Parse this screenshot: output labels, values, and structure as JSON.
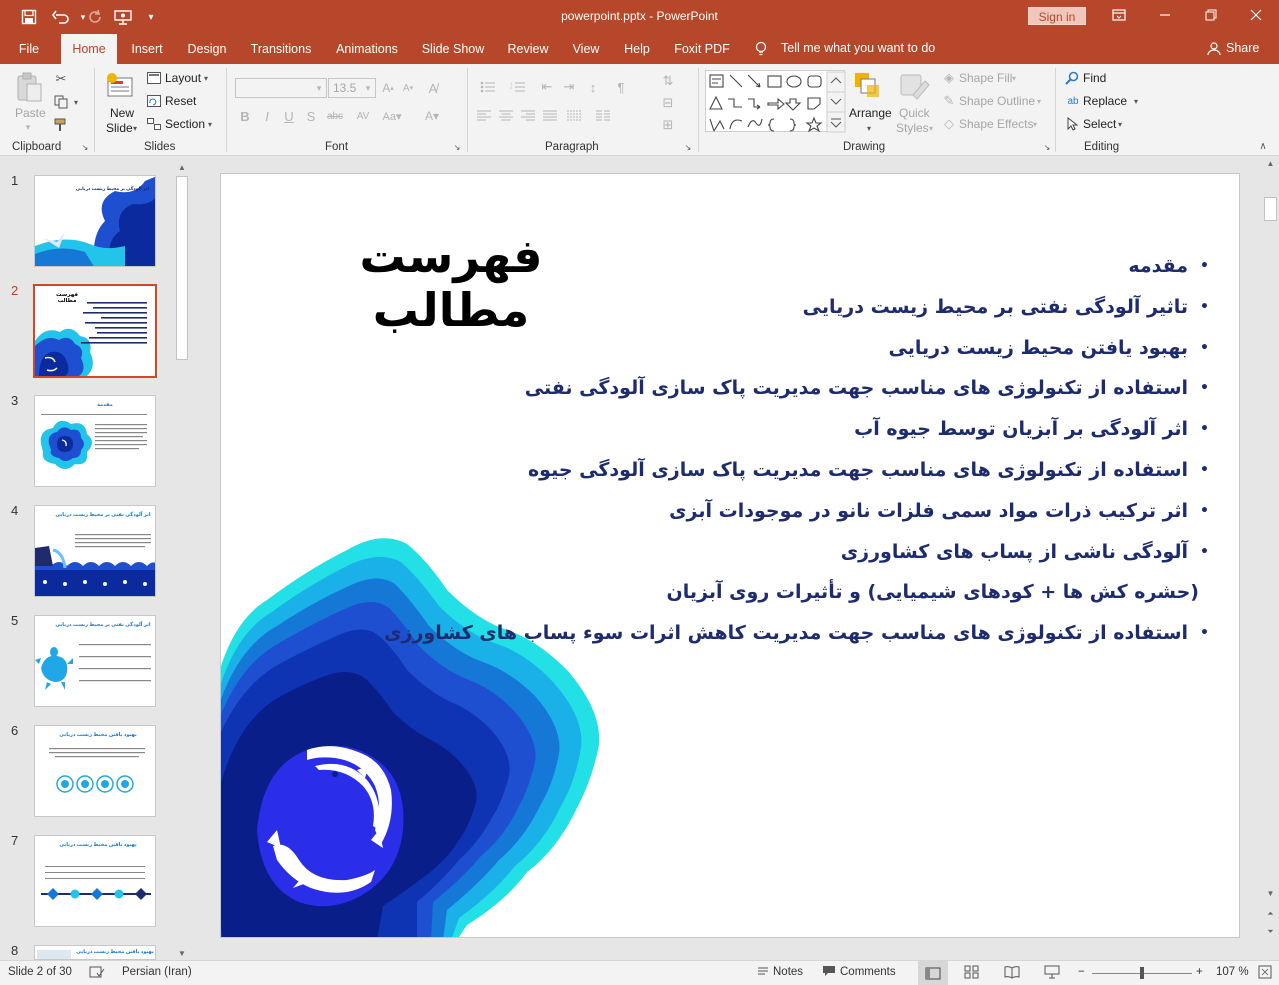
{
  "window": {
    "doc_title": "powerpoint.pptx  -  PowerPoint",
    "sign_in": "Sign in",
    "share": "Share"
  },
  "tabs": [
    {
      "label": "File"
    },
    {
      "label": "Home",
      "active": true
    },
    {
      "label": "Insert"
    },
    {
      "label": "Design"
    },
    {
      "label": "Transitions"
    },
    {
      "label": "Animations"
    },
    {
      "label": "Slide Show"
    },
    {
      "label": "Review"
    },
    {
      "label": "View"
    },
    {
      "label": "Help"
    },
    {
      "label": "Foxit PDF"
    }
  ],
  "tell_me": "Tell me what you want to do",
  "ribbon": {
    "clipboard": {
      "label": "Clipboard",
      "paste": "Paste"
    },
    "slides": {
      "label": "Slides",
      "new_slide_1": "New",
      "new_slide_2": "Slide",
      "layout": "Layout",
      "reset": "Reset",
      "section": "Section"
    },
    "font": {
      "label": "Font",
      "font_name": "",
      "font_size": "13.5"
    },
    "paragraph": {
      "label": "Paragraph"
    },
    "drawing": {
      "label": "Drawing",
      "arrange": "Arrange",
      "quick_styles_1": "Quick",
      "quick_styles_2": "Styles",
      "shape_fill": "Shape Fill",
      "shape_outline": "Shape Outline",
      "shape_effects": "Shape Effects"
    },
    "editing": {
      "label": "Editing",
      "find": "Find",
      "replace": "Replace",
      "select": "Select"
    }
  },
  "thumbnails": {
    "numbers": [
      "1",
      "2",
      "3",
      "4",
      "5",
      "6",
      "7",
      "8"
    ],
    "active_index": 2,
    "slide1_title": "اثر آلودگی بر محیط زیست دریایی",
    "slide2_title": "فهرست مطالب",
    "slide3_title": "مقدمه",
    "slide4_title": "اثر آلودگی نفتی بر محیط زیست دریایی",
    "slide5_title": "اثر آلودگی نفتی بر محیط زیست دریایی",
    "slide6_title": "بهبود یافتن محیط زیست دریایی",
    "slide7_title": "بهبود یافتن محیط زیست دریایی",
    "slide8_title": "بهبود یافتن محیط زیست دریایی"
  },
  "slide": {
    "title": "فهرست مطالب",
    "bullets": [
      {
        "text": "مقدمه",
        "bullet": true
      },
      {
        "text": "تاثیر آلودگی نفتی بر محیط زیست دریایی",
        "bullet": true
      },
      {
        "text": "بهبود یافتن محیط زیست دریایی",
        "bullet": true
      },
      {
        "text": "استفاده از تکنولوژی های مناسب  جهت مدیریت پاک سازی آلودگی نفتی",
        "bullet": true
      },
      {
        "text": "اثر آلودگی بر آبزیان توسط جیوه آب",
        "bullet": true
      },
      {
        "text": "استفاده از تکنولوژی های مناسب  جهت مدیریت پاک سازی آلودگی جیوه",
        "bullet": true
      },
      {
        "text": "اثر ترکیب ذرات مواد سمی فلزات نانو در موجودات آبزی",
        "bullet": true
      },
      {
        "text": "آلودگی ناشی از پساب های کشاورزی",
        "bullet": true
      },
      {
        "text": "(حشره کش ها + کودهای شیمیایی) و تأثیرات روی آبزیان",
        "bullet": false
      },
      {
        "text": "استفاده از تکنولوژی های مناسب جهت مدیریت کاهش اثرات سوء پساب های کشاورزی",
        "bullet": true
      }
    ],
    "colors": {
      "heading": "#000000",
      "bullets": "#1e2c6e",
      "accent": "#b7472a"
    }
  },
  "statusbar": {
    "slide_info": "Slide 2 of 30",
    "language": "Persian (Iran)",
    "notes": "Notes",
    "comments": "Comments",
    "zoom": "107 %",
    "zoom_minus": "−",
    "zoom_plus": "+"
  }
}
